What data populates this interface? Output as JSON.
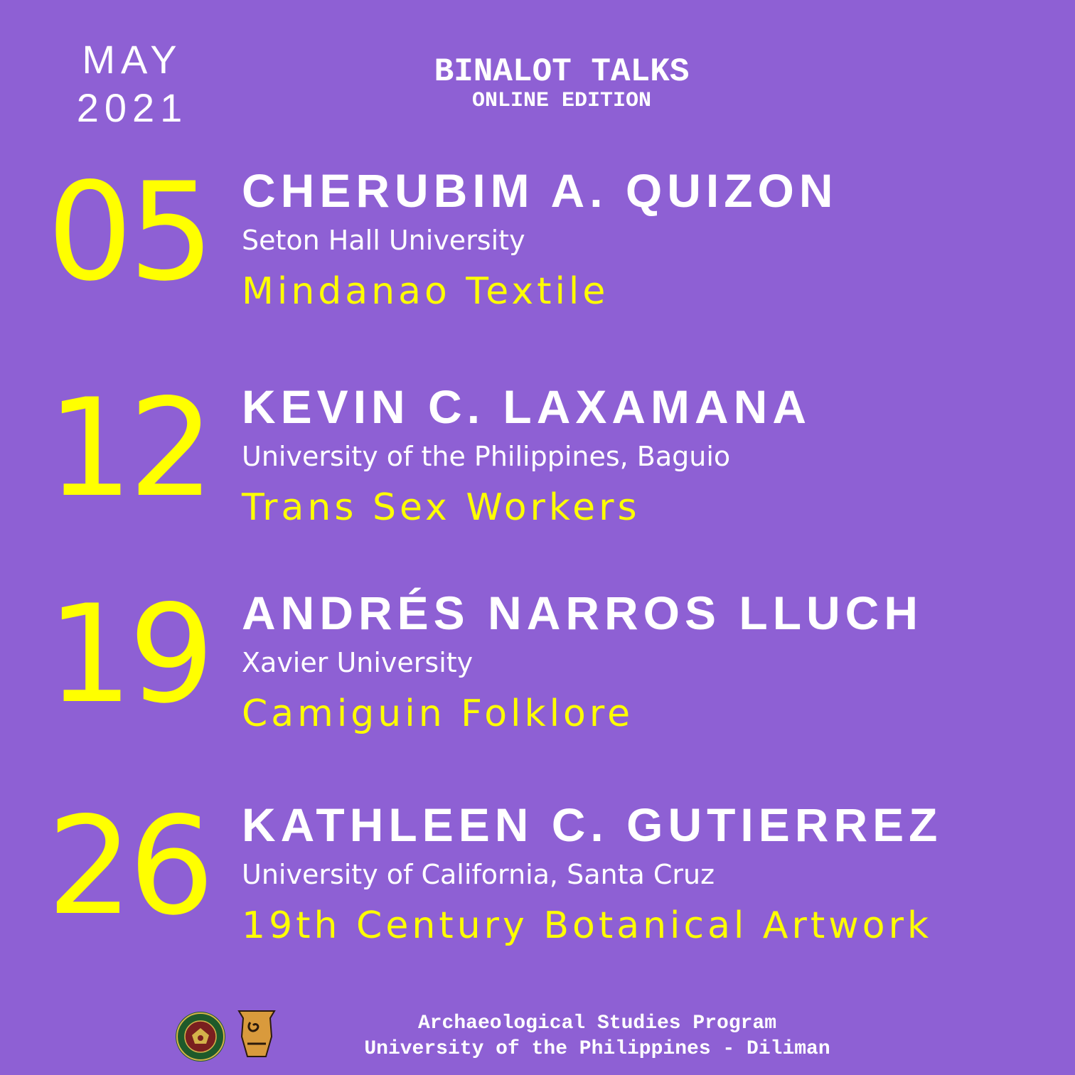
{
  "header": {
    "month": "MAY",
    "year": "2021",
    "title": "BINALOT TALKS",
    "subtitle": "ONLINE EDITION"
  },
  "events": [
    {
      "day": "05",
      "name": "CHERUBIM A. QUIZON",
      "affiliation": "Seton Hall University",
      "topic": "Mindanao Textile"
    },
    {
      "day": "12",
      "name": "KEVIN C. LAXAMANA",
      "affiliation": "University of the Philippines, Baguio",
      "topic": "Trans Sex Workers"
    },
    {
      "day": "19",
      "name": "ANDRÉS NARROS LLUCH",
      "affiliation": "Xavier University",
      "topic": "Camiguin Folklore"
    },
    {
      "day": "26",
      "name": "KATHLEEN C. GUTIERREZ",
      "affiliation": "University of California, Santa Cruz",
      "topic": "19th Century Botanical Artwork"
    }
  ],
  "footer": {
    "line1": "Archaeological Studies Program",
    "line2": "University of the Philippines - Diliman"
  },
  "logos": {
    "seal_icon": "up-seal-icon",
    "pot_icon": "manunggul-jar-icon",
    "seal_text": "UNIVERSITY OF THE PHILIPPINES 1908"
  },
  "colors": {
    "background": "#8e60d4",
    "accent": "#ffff00",
    "text": "#ffffff"
  }
}
